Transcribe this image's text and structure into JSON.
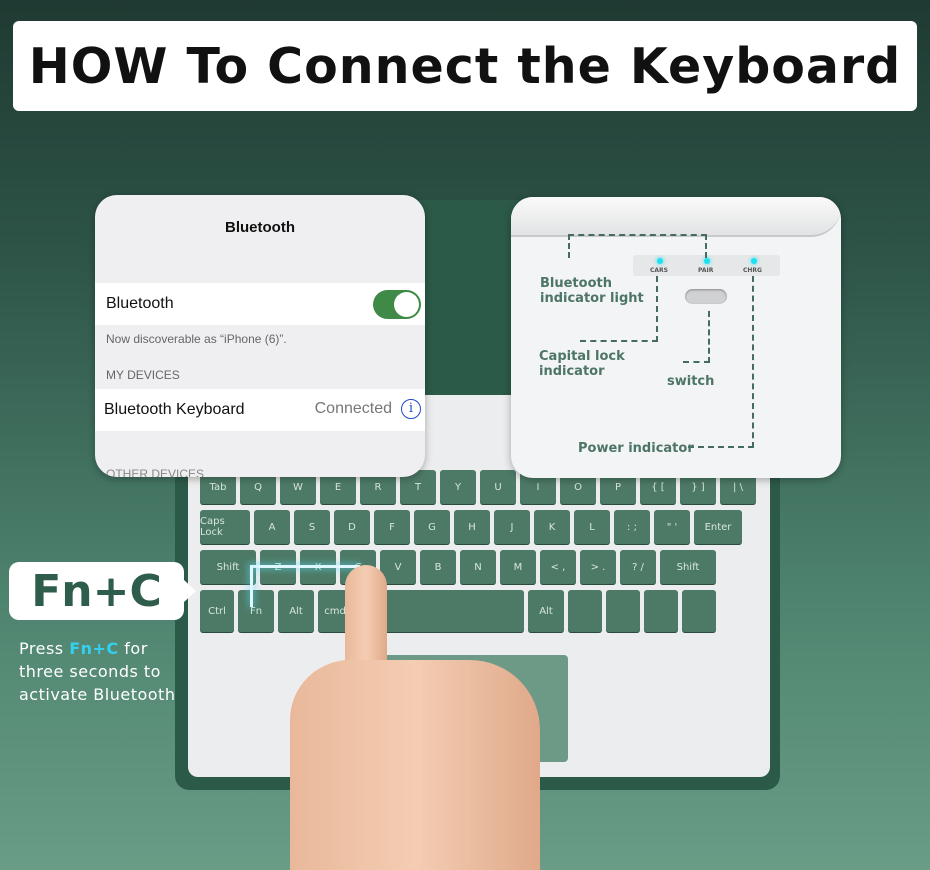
{
  "title": "HOW To Connect the Keyboard",
  "bluetooth_panel": {
    "header": "Bluetooth",
    "toggle_label": "Bluetooth",
    "toggle_on": true,
    "discoverable_note": "Now discoverable as “iPhone (6)”.",
    "section_label": "MY DEVICES",
    "device_name": "Bluetooth Keyboard",
    "device_status": "Connected",
    "other_section": "OTHER DEVICES",
    "toggle_color": "#3f8a46"
  },
  "indicator_panel": {
    "leds": [
      "CARS",
      "PAIR",
      "CHRG"
    ],
    "labels": {
      "bluetooth": "Bluetooth indicator light",
      "caps": "Capital lock indicator",
      "switch": "switch",
      "power": "Power indicator"
    },
    "led_color": "#1fe0f0"
  },
  "keyboard": {
    "rows": [
      [
        "Tab",
        "Q",
        "W",
        "E",
        "R",
        "T",
        "Y",
        "U",
        "I",
        "O",
        "P",
        "{ [",
        "} ]",
        "| \\"
      ],
      [
        "Caps Lock",
        "A",
        "S",
        "D",
        "F",
        "G",
        "H",
        "J",
        "K",
        "L",
        ": ;",
        "\" '",
        "Enter"
      ],
      [
        "Shift",
        "Z",
        "X",
        "C",
        "V",
        "B",
        "N",
        "M",
        "< ,",
        "> .",
        "? /",
        "Shift"
      ],
      [
        "Ctrl",
        "Fn",
        "Alt",
        "cmd",
        "",
        "Alt",
        "",
        "",
        "",
        ""
      ]
    ],
    "key_color": "#4d7a66"
  },
  "callout": {
    "combo": "Fn+C",
    "press_pre": "Press",
    "press_combo": "Fn+C",
    "press_post": "for",
    "line2": "three seconds to",
    "line3": "activate Bluetooth"
  }
}
